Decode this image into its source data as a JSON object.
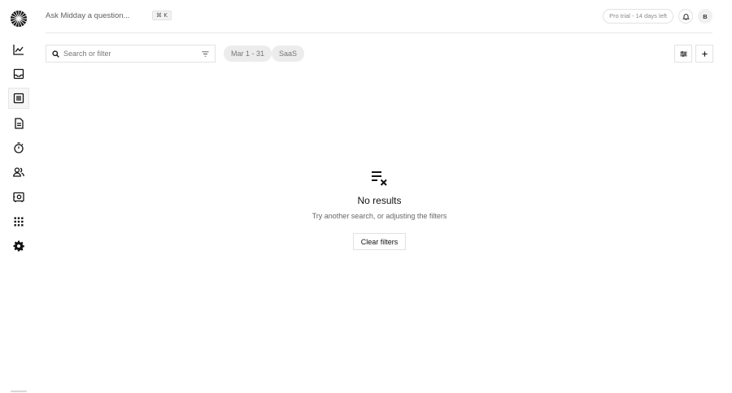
{
  "header": {
    "ask_text": "Ask Midday a question...",
    "shortcut": "⌘ K",
    "trial_badge": "Pro trial - 14 days left",
    "avatar_initial": "B"
  },
  "sidebar": {
    "items": [
      {
        "name": "overview",
        "icon": "chart-line-icon"
      },
      {
        "name": "inbox",
        "icon": "inbox-icon"
      },
      {
        "name": "transactions",
        "icon": "list-icon",
        "active": true
      },
      {
        "name": "invoices",
        "icon": "document-icon"
      },
      {
        "name": "tracker",
        "icon": "timer-icon"
      },
      {
        "name": "customers",
        "icon": "people-icon"
      },
      {
        "name": "vault",
        "icon": "vault-icon"
      },
      {
        "name": "apps",
        "icon": "apps-grid-icon"
      },
      {
        "name": "settings",
        "icon": "gear-icon"
      }
    ]
  },
  "toolbar": {
    "search_placeholder": "Search or filter",
    "filters": [
      "Mar 1 - 31",
      "SaaS"
    ]
  },
  "empty_state": {
    "title": "No results",
    "subtitle": "Try another search, or adjusting the filters",
    "button_label": "Clear filters"
  }
}
